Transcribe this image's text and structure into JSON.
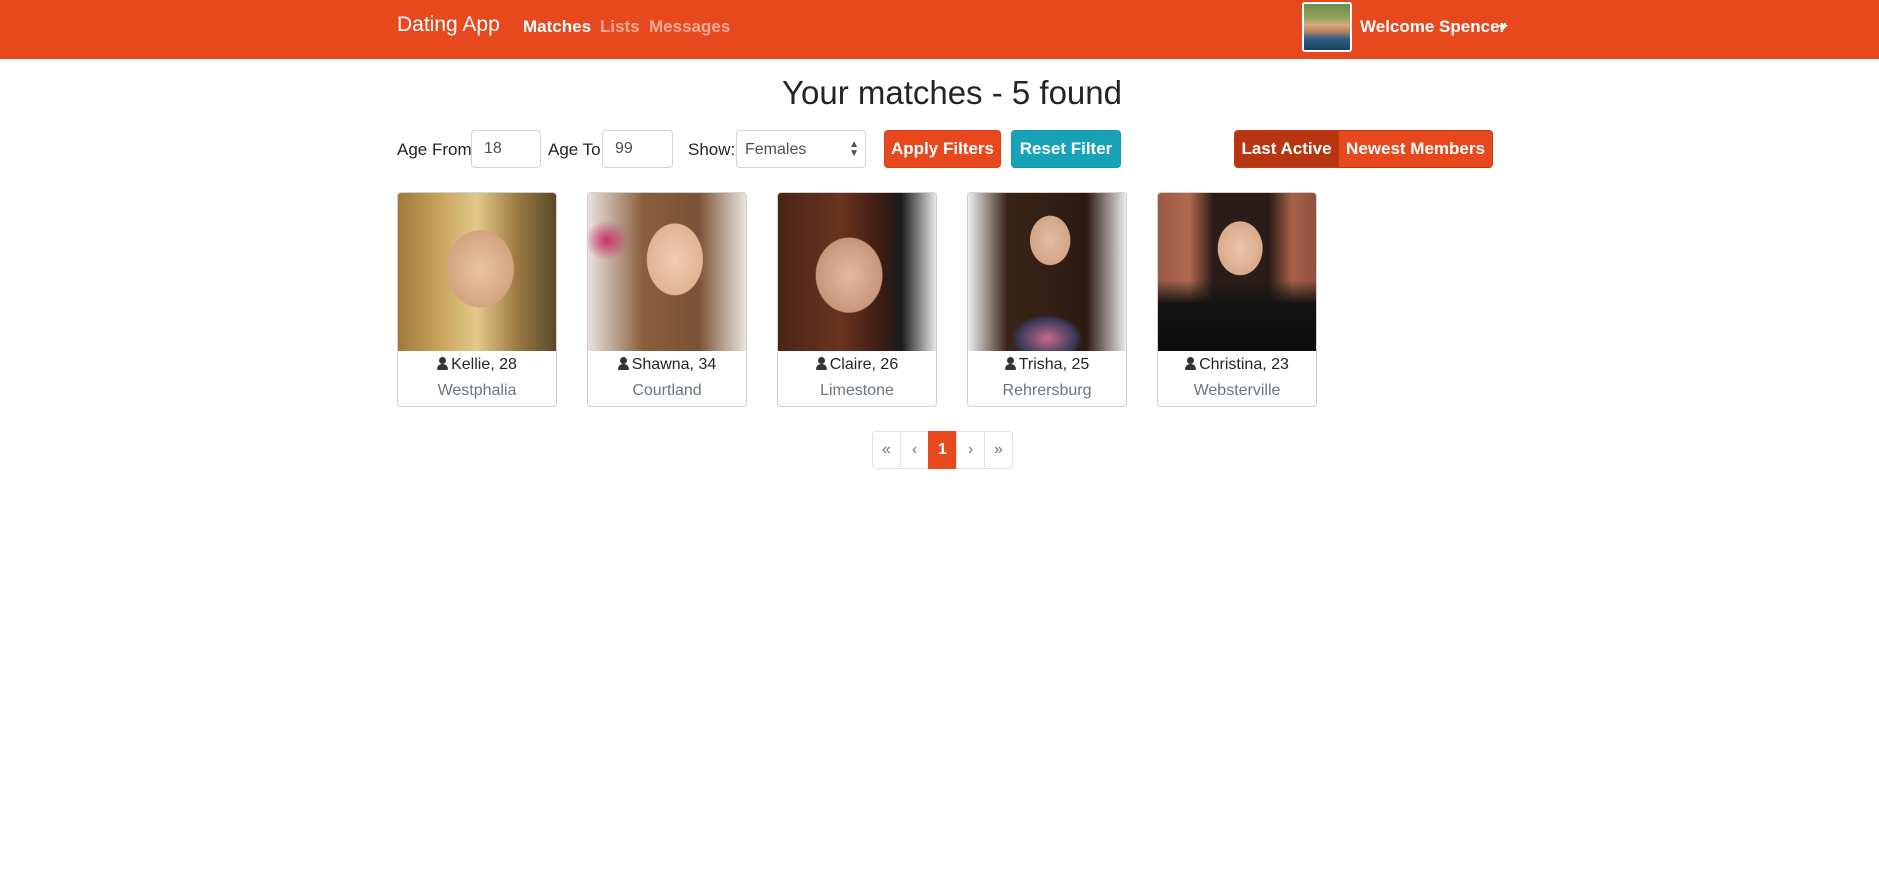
{
  "navbar": {
    "brand": "Dating App",
    "links": [
      {
        "label": "Matches",
        "active": true
      },
      {
        "label": "Lists",
        "active": false
      },
      {
        "label": "Messages",
        "active": false
      }
    ],
    "welcome": "Welcome Spencer",
    "accent_color": "#e7481d"
  },
  "page": {
    "title": "Your matches - 5 found"
  },
  "filters": {
    "age_from_label": "Age From",
    "age_from_value": "18",
    "age_to_label": "Age To",
    "age_to_value": "99",
    "show_label": "Show:",
    "show_value": "Females",
    "apply_label": "Apply Filters",
    "reset_label": "Reset Filter"
  },
  "sort": {
    "options": [
      {
        "label": "Last Active",
        "active": true
      },
      {
        "label": "Newest Members",
        "active": false
      }
    ]
  },
  "members": [
    {
      "name_age": "Kellie, 28",
      "city": "Westphalia"
    },
    {
      "name_age": "Shawna, 34",
      "city": "Courtland"
    },
    {
      "name_age": "Claire, 26",
      "city": "Limestone"
    },
    {
      "name_age": "Trisha, 25",
      "city": "Rehrersburg"
    },
    {
      "name_age": "Christina, 23",
      "city": "Websterville"
    }
  ],
  "pagination": {
    "first": "«",
    "prev": "‹",
    "current": "1",
    "next": "›",
    "last": "»"
  }
}
